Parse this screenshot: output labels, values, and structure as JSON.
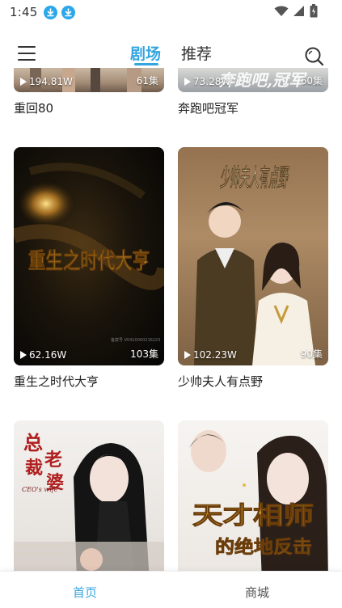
{
  "status_bar": {
    "time": "1:45"
  },
  "header": {
    "tabs": [
      {
        "label": "剧场",
        "active": true
      },
      {
        "label": "推荐",
        "active": false
      }
    ]
  },
  "dramas": [
    {
      "title": "重回80",
      "plays": "194.81W",
      "episodes": "61集"
    },
    {
      "title": "奔跑吧冠军",
      "plays": "73.28W",
      "episodes": "60集",
      "poster_text": "奔跑吧,冠军"
    },
    {
      "title": "重生之时代大亨",
      "plays": "62.16W",
      "episodes": "103集",
      "poster_text": "重生之时代大亨"
    },
    {
      "title": "少帅夫人有点野",
      "plays": "102.23W",
      "episodes": "90集",
      "poster_text": "少帅夫人有点野"
    },
    {
      "title": "",
      "plays": "",
      "episodes": "",
      "poster_text": "总裁老婆",
      "poster_subtext": "CEO's wife"
    },
    {
      "title": "",
      "plays": "",
      "episodes": "",
      "poster_text": "天才相师",
      "poster_subtext": "的绝地反击"
    }
  ],
  "bottom_nav": {
    "items": [
      {
        "label": "首页",
        "active": true
      },
      {
        "label": "商城",
        "active": false
      }
    ]
  },
  "colors": {
    "accent": "#35a5e0",
    "text": "#222222"
  }
}
